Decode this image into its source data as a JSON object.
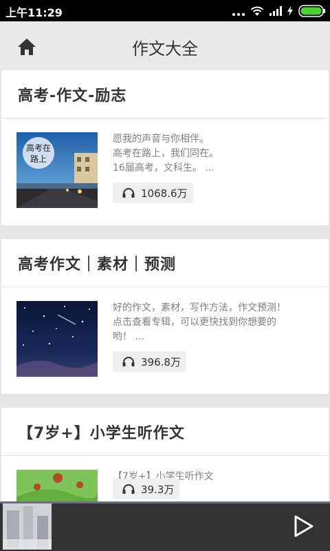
{
  "status": {
    "time": "上午11:29"
  },
  "header": {
    "title": "作文大全",
    "home_icon": "home-icon"
  },
  "albums": [
    {
      "title": "高考-作文-励志",
      "thumb_text": [
        "高考在",
        "路上"
      ],
      "desc_lines": [
        "愿我的声音与你相伴。",
        "高考在路上，我们同在。",
        "16届高考，文科生。 ..."
      ],
      "plays": "1068.6万"
    },
    {
      "title": "高考作文｜素材｜预测",
      "desc_lines": [
        "好的作文，素材，写作方法，作文预测！",
        "点击查看专辑，可以更快找到你想要的",
        "哟！ ..."
      ],
      "plays": "396.8万"
    },
    {
      "title": "【7岁+】小学生听作文",
      "desc_lines": [
        "【7岁+】小学生听作文"
      ],
      "plays": "39.3万"
    }
  ],
  "player": {
    "play_icon": "play-icon"
  }
}
